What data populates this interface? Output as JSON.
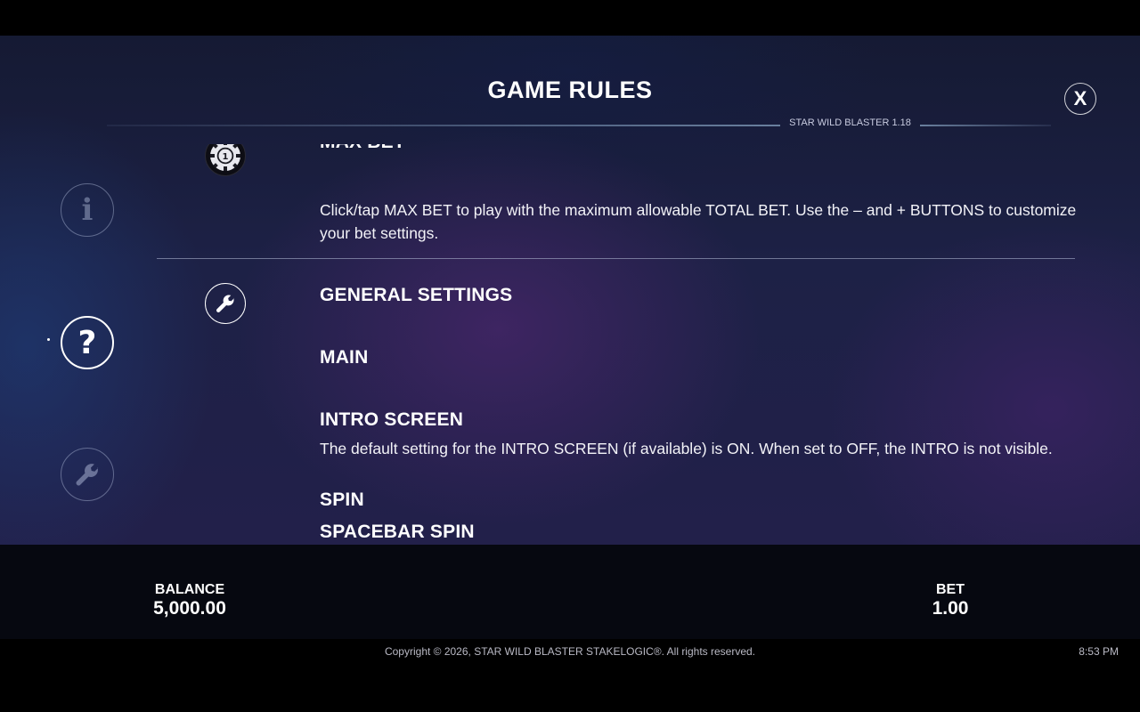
{
  "header": {
    "title": "GAME RULES",
    "version": "STAR WILD BLASTER 1.18",
    "close_label": "X"
  },
  "nav": {
    "items": [
      {
        "icon": "info-icon",
        "glyph": "i",
        "state": "dim"
      },
      {
        "icon": "help-icon",
        "glyph": "?",
        "state": "active"
      },
      {
        "icon": "wrench-icon",
        "glyph": "",
        "state": "dim"
      }
    ]
  },
  "content": {
    "max_bet": {
      "icon": "chip-icon",
      "chip_label": "1",
      "heading": "MAX BET",
      "text": "Click/tap MAX BET to play with the maximum allowable TOTAL BET. Use the – and + BUTTONS to customize your bet settings."
    },
    "general_settings": {
      "icon": "wrench-icon",
      "heading": "GENERAL SETTINGS"
    },
    "main": {
      "heading": "MAIN"
    },
    "intro_screen": {
      "heading": "INTRO SCREEN",
      "text": "The default setting for the INTRO SCREEN (if available) is ON. When set to OFF, the INTRO is not visible."
    },
    "spin": {
      "heading": "SPIN"
    },
    "spacebar_spin": {
      "heading": "SPACEBAR SPIN"
    }
  },
  "bottom_bar": {
    "balance_label": "BALANCE",
    "balance_value": "5,000.00",
    "bet_label": "BET",
    "bet_value": "1.00"
  },
  "footer": {
    "copyright": "Copyright © 2026, STAR WILD BLASTER STAKELOGIC®. All rights reserved.",
    "time": "8:53 PM"
  }
}
